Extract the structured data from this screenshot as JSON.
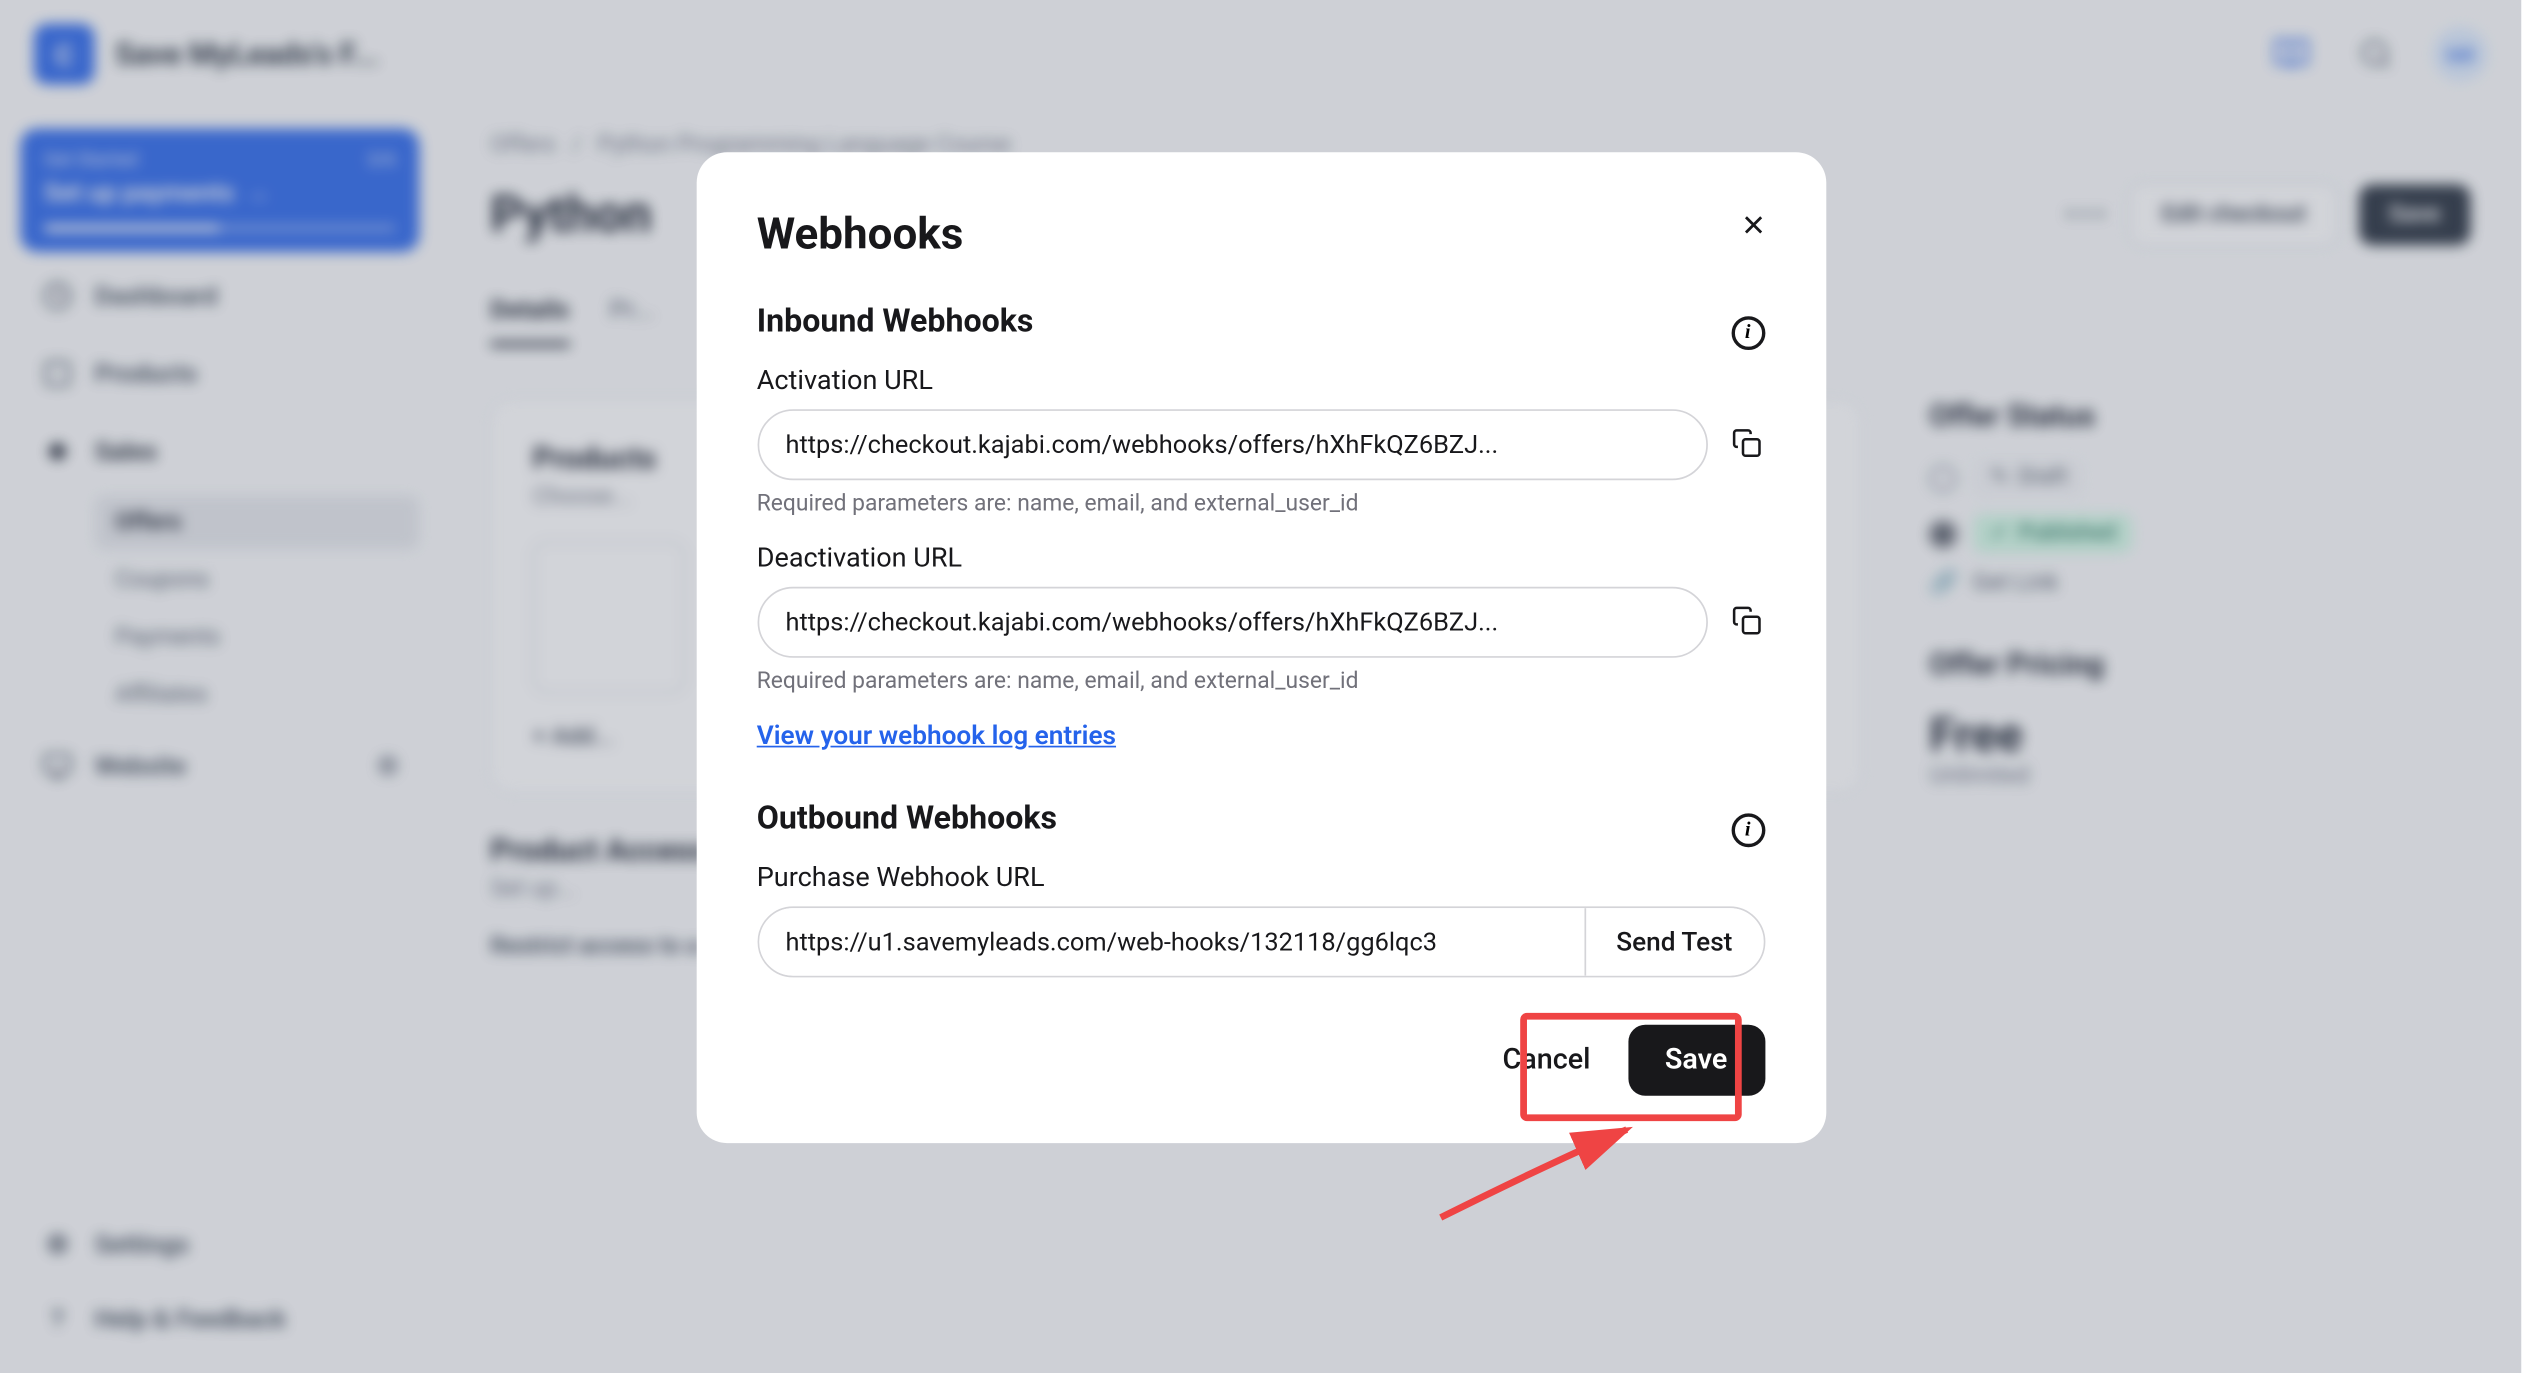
{
  "topbar": {
    "logo_letter": "C",
    "site_title": "Save MyLeads's F...",
    "avatar": "init"
  },
  "sidebar": {
    "get_started": {
      "small_label": "Get Started",
      "count": "3/6",
      "main_label": "Set up payments"
    },
    "items": [
      {
        "label": "Dashboard"
      },
      {
        "label": "Products"
      },
      {
        "label": "Sales"
      },
      {
        "label": "Website"
      }
    ],
    "sales_sub": [
      {
        "label": "Offers"
      },
      {
        "label": "Coupons"
      },
      {
        "label": "Payments"
      },
      {
        "label": "Affiliates"
      }
    ],
    "bottom": [
      {
        "label": "Settings"
      },
      {
        "label": "Help & Feedback"
      }
    ]
  },
  "main": {
    "breadcrumb_a": "Offers",
    "breadcrumb_sep": "/",
    "breadcrumb_b": "Python Programming Language Course",
    "title": "Python",
    "edit_checkout": "Edit checkout",
    "save": "Save",
    "tabs": [
      {
        "label": "Details",
        "active": true
      },
      {
        "label": "Pr..."
      }
    ],
    "products_heading": "Products",
    "products_sub": "Choose...",
    "add_label": "+  Add...",
    "product_access_heading": "Product Access",
    "product_access_sub": "Set up...",
    "restrict_label": "Restrict access to a specific amount of days",
    "right": {
      "status_heading": "Offer Status",
      "draft_label": "Draft",
      "published_label": "Published",
      "get_link": "Get Link",
      "pricing_heading": "Offer Pricing",
      "price": "Free",
      "price_sub": "Unlimited"
    }
  },
  "modal": {
    "title": "Webhooks",
    "inbound_heading": "Inbound Webhooks",
    "activation_label": "Activation URL",
    "activation_value": "https://checkout.kajabi.com/webhooks/offers/hXhFkQZ6BZJ...",
    "deactivation_label": "Deactivation URL",
    "deactivation_value": "https://checkout.kajabi.com/webhooks/offers/hXhFkQZ6BZJ...",
    "required_helper": "Required parameters are: name, email, and external_user_id",
    "log_link": "View your webhook log entries",
    "outbound_heading": "Outbound Webhooks",
    "purchase_label": "Purchase Webhook URL",
    "purchase_value": "https://u1.savemyleads.com/web-hooks/132118/gg6lqc3",
    "send_test": "Send Test",
    "cancel": "Cancel",
    "save": "Save"
  }
}
